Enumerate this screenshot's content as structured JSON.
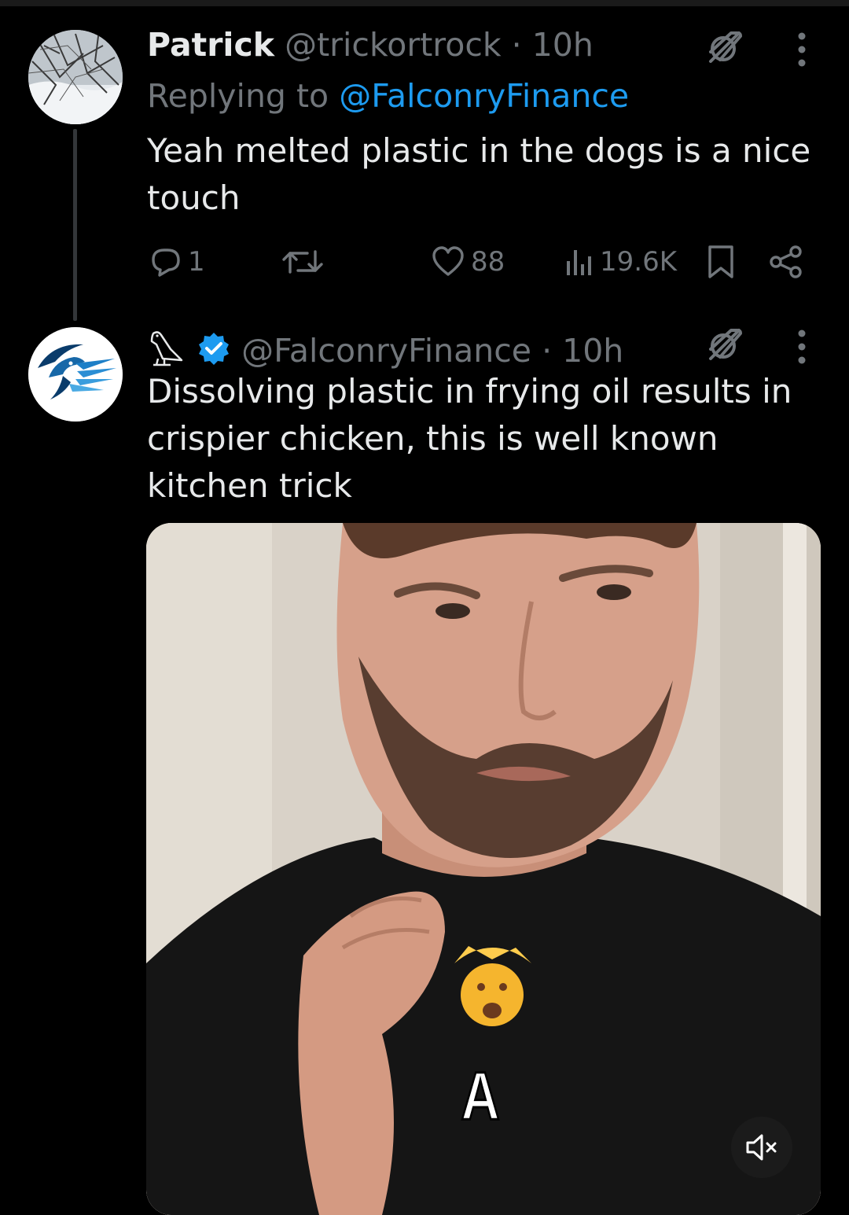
{
  "tweets": [
    {
      "name": "Patrick",
      "handle": "@trickortrock",
      "time": "· 10h",
      "replying_prefix": "Replying to",
      "replying_handle": "@FalconryFinance",
      "text": "Yeah melted plastic in the dogs is a nice touch",
      "stats": {
        "replies": "1",
        "likes": "88",
        "views": "19.6K"
      }
    },
    {
      "handle": "@FalconryFinance",
      "time": "· 10h",
      "text": "Dissolving plastic in frying oil results in crispier chicken, this is well known kitchen trick",
      "video_caption": "A"
    }
  ],
  "icons": {
    "grok": "grok-icon",
    "more": "more-icon",
    "reply": "reply-icon",
    "retweet": "retweet-icon",
    "like": "heart-icon",
    "views": "views-icon",
    "bookmark": "bookmark-icon",
    "share": "share-icon",
    "mute": "muted-speaker-icon",
    "badge": "verified-badge-icon",
    "affiliate": "falcon-affiliate-icon"
  },
  "colors": {
    "background": "#000000",
    "text": "#e7e9ea",
    "muted": "#71767b",
    "link": "#1d9bf0",
    "verified": "#1d9bf0"
  }
}
